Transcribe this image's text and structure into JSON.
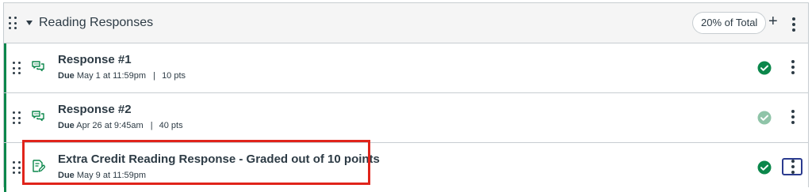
{
  "group": {
    "title": "Reading Responses",
    "weight_badge": "20% of Total",
    "add_label": "+",
    "icons": [
      "drag-handle-icon",
      "collapse-caret-icon",
      "plus-icon",
      "more-options-icon"
    ]
  },
  "assignments": [
    {
      "title": "Response #1",
      "due_label": "Due",
      "due_date": "May 1 at 11:59pm",
      "separator": "|",
      "points": "10 pts",
      "type_icon": "discussion-icon",
      "status": "published",
      "status_color": "#0b874b"
    },
    {
      "title": "Response #2",
      "due_label": "Due",
      "due_date": "Apr 26 at 9:45am",
      "separator": "|",
      "points": "40 pts",
      "type_icon": "discussion-icon",
      "status": "published-faded",
      "status_color": "#8fc4a8"
    },
    {
      "title": "Extra Credit Reading Response - Graded out of 10 points",
      "due_label": "Due",
      "due_date": "May 9 at 11:59pm",
      "type_icon": "assignment-edit-icon",
      "status": "published",
      "status_color": "#0b874b"
    }
  ],
  "colors": {
    "accent_green": "#0b874b",
    "highlight_red": "#e0241b",
    "focus_ring": "#2b3b8f",
    "header_bg": "#f5f5f5"
  }
}
